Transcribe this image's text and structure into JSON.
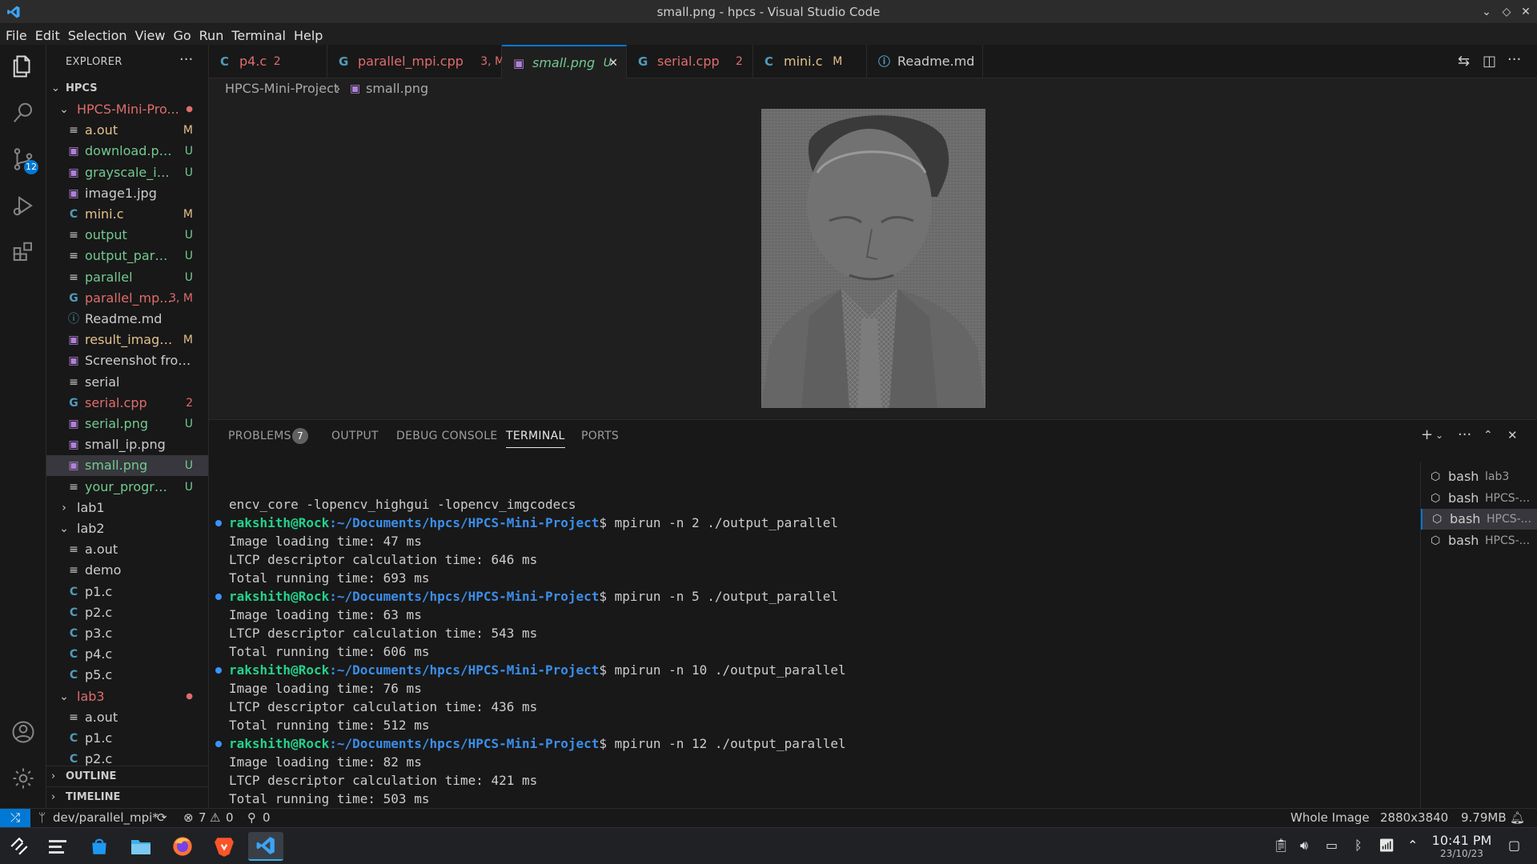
{
  "window": {
    "title": "small.png - hpcs - Visual Studio Code"
  },
  "menu": [
    "File",
    "Edit",
    "Selection",
    "View",
    "Go",
    "Run",
    "Terminal",
    "Help"
  ],
  "activity": {
    "scm_badge": "12"
  },
  "explorer": {
    "header": "EXPLORER",
    "more": "···",
    "root": "HPCS",
    "tree": [
      {
        "label": "HPCS-Mini-Pro...",
        "status": "",
        "kind": "folder-open",
        "depth": 1,
        "color": "#e06c6c",
        "dot": true
      },
      {
        "label": "a.out",
        "status": "M",
        "kind": "file",
        "depth": 2,
        "color": "#e2c08d"
      },
      {
        "label": "download.png",
        "status": "U",
        "kind": "image",
        "depth": 2,
        "color": "#73c991"
      },
      {
        "label": "grayscale_ima...",
        "status": "U",
        "kind": "image",
        "depth": 2,
        "color": "#73c991"
      },
      {
        "label": "image1.jpg",
        "status": "",
        "kind": "image",
        "depth": 2,
        "color": "#cccccc"
      },
      {
        "label": "mini.c",
        "status": "M",
        "kind": "c",
        "depth": 2,
        "color": "#e2c08d"
      },
      {
        "label": "output",
        "status": "U",
        "kind": "file",
        "depth": 2,
        "color": "#73c991"
      },
      {
        "label": "output_parallel",
        "status": "U",
        "kind": "file",
        "depth": 2,
        "color": "#73c991"
      },
      {
        "label": "parallel",
        "status": "U",
        "kind": "file",
        "depth": 2,
        "color": "#73c991"
      },
      {
        "label": "parallel_mp...",
        "status": "3, M",
        "kind": "cpp",
        "depth": 2,
        "color": "#e06c6c"
      },
      {
        "label": "Readme.md",
        "status": "",
        "kind": "info",
        "depth": 2,
        "color": "#cccccc"
      },
      {
        "label": "result_image....",
        "status": "M",
        "kind": "image",
        "depth": 2,
        "color": "#e2c08d"
      },
      {
        "label": "Screenshot from 2...",
        "status": "",
        "kind": "image",
        "depth": 2,
        "color": "#cccccc"
      },
      {
        "label": "serial",
        "status": "",
        "kind": "file",
        "depth": 2,
        "color": "#cccccc"
      },
      {
        "label": "serial.cpp",
        "status": "2",
        "kind": "cpp",
        "depth": 2,
        "color": "#e06c6c"
      },
      {
        "label": "serial.png",
        "status": "U",
        "kind": "image",
        "depth": 2,
        "color": "#73c991"
      },
      {
        "label": "small_ip.png",
        "status": "",
        "kind": "image",
        "depth": 2,
        "color": "#cccccc"
      },
      {
        "label": "small.png",
        "status": "U",
        "kind": "image",
        "depth": 2,
        "color": "#73c991",
        "selected": true
      },
      {
        "label": "your_program",
        "status": "U",
        "kind": "file",
        "depth": 2,
        "color": "#73c991"
      },
      {
        "label": "lab1",
        "status": "",
        "kind": "folder",
        "depth": 1,
        "color": "#cccccc"
      },
      {
        "label": "lab2",
        "status": "",
        "kind": "folder-open",
        "depth": 1,
        "color": "#cccccc"
      },
      {
        "label": "a.out",
        "status": "",
        "kind": "file",
        "depth": 2,
        "color": "#cccccc"
      },
      {
        "label": "demo",
        "status": "",
        "kind": "file",
        "depth": 2,
        "color": "#cccccc"
      },
      {
        "label": "p1.c",
        "status": "",
        "kind": "c",
        "depth": 2,
        "color": "#cccccc"
      },
      {
        "label": "p2.c",
        "status": "",
        "kind": "c",
        "depth": 2,
        "color": "#cccccc"
      },
      {
        "label": "p3.c",
        "status": "",
        "kind": "c",
        "depth": 2,
        "color": "#cccccc"
      },
      {
        "label": "p4.c",
        "status": "",
        "kind": "c",
        "depth": 2,
        "color": "#cccccc"
      },
      {
        "label": "p5.c",
        "status": "",
        "kind": "c",
        "depth": 2,
        "color": "#cccccc"
      },
      {
        "label": "lab3",
        "status": "",
        "kind": "folder-open",
        "depth": 1,
        "color": "#e06c6c",
        "dot": true
      },
      {
        "label": "a.out",
        "status": "",
        "kind": "file",
        "depth": 2,
        "color": "#cccccc"
      },
      {
        "label": "p1.c",
        "status": "",
        "kind": "c",
        "depth": 2,
        "color": "#cccccc"
      },
      {
        "label": "p2.c",
        "status": "",
        "kind": "c",
        "depth": 2,
        "color": "#cccccc"
      }
    ],
    "outline": "OUTLINE",
    "timeline": "TIMELINE"
  },
  "tabs": [
    {
      "label": "p4.c",
      "status": "2",
      "kind": "c",
      "color": "#e06c6c"
    },
    {
      "label": "parallel_mpi.cpp",
      "status": "3, M",
      "kind": "cpp",
      "color": "#e06c6c"
    },
    {
      "label": "small.png",
      "status": "U",
      "kind": "image",
      "color": "#73c991",
      "active": true,
      "close": "✕"
    },
    {
      "label": "serial.cpp",
      "status": "2",
      "kind": "cpp",
      "color": "#e06c6c"
    },
    {
      "label": "mini.c",
      "status": "M",
      "kind": "c",
      "color": "#e2c08d"
    },
    {
      "label": "Readme.md",
      "status": "",
      "kind": "info",
      "color": "#cccccc"
    }
  ],
  "breadcrumb": {
    "folder": "HPCS-Mini-Project",
    "sep": "›",
    "file": "small.png"
  },
  "panel": {
    "tabs": [
      "PROBLEMS",
      "OUTPUT",
      "DEBUG CONSOLE",
      "TERMINAL",
      "PORTS"
    ],
    "problems_count": "7",
    "active_tab": "TERMINAL"
  },
  "terminal": {
    "user": "rakshith@Rock",
    "path": ":~/Documents/hpcs/HPCS-Mini-Project",
    "prompt_end": "$",
    "lines": [
      {
        "type": "out",
        "text": "encv_core -lopencv_highgui -lopencv_imgcodecs"
      },
      {
        "type": "cmd",
        "cmd": " mpirun -n 2 ./output_parallel"
      },
      {
        "type": "out",
        "text": "Image loading time: 47 ms"
      },
      {
        "type": "out",
        "text": "LTCP descriptor calculation time: 646 ms"
      },
      {
        "type": "out",
        "text": "Total running time: 693 ms"
      },
      {
        "type": "cmd",
        "cmd": " mpirun -n 5 ./output_parallel"
      },
      {
        "type": "out",
        "text": "Image loading time: 63 ms"
      },
      {
        "type": "out",
        "text": "LTCP descriptor calculation time: 543 ms"
      },
      {
        "type": "out",
        "text": "Total running time: 606 ms"
      },
      {
        "type": "cmd",
        "cmd": " mpirun -n 10 ./output_parallel"
      },
      {
        "type": "out",
        "text": "Image loading time: 76 ms"
      },
      {
        "type": "out",
        "text": "LTCP descriptor calculation time: 436 ms"
      },
      {
        "type": "out",
        "text": "Total running time: 512 ms"
      },
      {
        "type": "cmd",
        "cmd": " mpirun -n 12 ./output_parallel"
      },
      {
        "type": "out",
        "text": "Image loading time: 82 ms"
      },
      {
        "type": "out",
        "text": "LTCP descriptor calculation time: 421 ms"
      },
      {
        "type": "out",
        "text": "Total running time: 503 ms"
      },
      {
        "type": "prompt",
        "cmd": " "
      }
    ],
    "sessions": [
      {
        "name": "bash",
        "sub": "lab3"
      },
      {
        "name": "bash",
        "sub": "HPCS-..."
      },
      {
        "name": "bash",
        "sub": "HPCS-...",
        "selected": true
      },
      {
        "name": "bash",
        "sub": "HPCS-..."
      }
    ]
  },
  "status": {
    "branch": "dev/parallel_mpi*",
    "errors": "7",
    "warnings": "0",
    "ports": "0",
    "zoom": "Whole Image",
    "dimensions": "2880x3840",
    "size": "9.79MB"
  },
  "taskbar": {
    "time": "10:41 PM",
    "date": "23/10/23"
  }
}
